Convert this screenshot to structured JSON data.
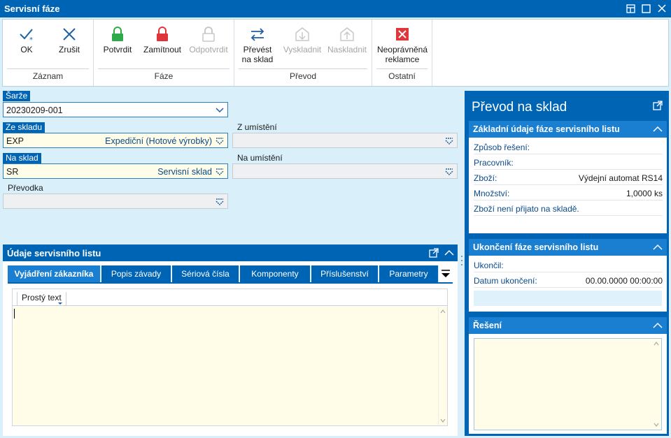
{
  "window": {
    "title": "Servisní fáze",
    "controls": [
      "restore-icon",
      "maximize-icon",
      "close-icon"
    ]
  },
  "ribbon": {
    "groups": [
      {
        "name": "Záznam",
        "buttons": [
          {
            "label": "OK",
            "icon": "check-star-icon",
            "enabled": true
          },
          {
            "label": "Zrušit",
            "icon": "x-icon",
            "enabled": true
          }
        ]
      },
      {
        "name": "Fáze",
        "buttons": [
          {
            "label": "Potvrdit",
            "icon": "lock-green-icon",
            "enabled": true
          },
          {
            "label": "Zamítnout",
            "icon": "lock-red-icon",
            "enabled": true
          },
          {
            "label": "Odpotvrdit",
            "icon": "lock-open-icon",
            "enabled": false
          }
        ]
      },
      {
        "name": "Převod",
        "buttons": [
          {
            "label": "Převést\nna sklad",
            "icon": "transfer-arrows-icon",
            "enabled": true
          },
          {
            "label": "Vyskladnit",
            "icon": "warehouse-out-icon",
            "enabled": false
          },
          {
            "label": "Naskladnit",
            "icon": "warehouse-in-icon",
            "enabled": false
          }
        ]
      },
      {
        "name": "Ostatní",
        "buttons": [
          {
            "label": "Neoprávněná\nreklamce",
            "icon": "red-x-box-icon",
            "enabled": true
          }
        ]
      }
    ]
  },
  "form": {
    "sarze_label": "Šarže",
    "sarze_value": "20230209-001",
    "ze_skladu_label": "Ze skladu",
    "ze_skladu_code": "EXP",
    "ze_skladu_name": "Expediční (Hotové výrobky)",
    "z_umisteni_label": "Z umístění",
    "na_sklad_label": "Na sklad",
    "na_sklad_code": "SR",
    "na_sklad_name": "Servisní sklad",
    "na_umisteni_label": "Na umístění",
    "prevodka_label": "Převodka"
  },
  "udaje": {
    "title": "Údaje servisního listu",
    "tabs": [
      "Vyjádření zákazníka",
      "Popis závady",
      "Sériová čísla",
      "Komponenty",
      "Příslušenství",
      "Parametry"
    ],
    "active_tab": "Vyjádření zákazníka",
    "editor_mode": "Prostý text"
  },
  "side": {
    "title": "Převod na sklad",
    "section1": {
      "title": "Základní údaje fáze servisního listu",
      "rows": [
        {
          "label": "Způsob řešení:",
          "value": ""
        },
        {
          "label": "Pracovník:",
          "value": ""
        },
        {
          "label": "Zboží:",
          "value": "Výdejní automat RS14"
        },
        {
          "label": "Množství:",
          "value": "1,0000 ks"
        }
      ],
      "note": "Zboží není přijato na skladě."
    },
    "section2": {
      "title": "Ukončení fáze servisního listu",
      "rows": [
        {
          "label": "Ukončil:",
          "value": ""
        },
        {
          "label": "Datum ukončení:",
          "value": "00.00.0000 00:00:00"
        }
      ]
    },
    "section3": {
      "title": "Řešení"
    }
  },
  "colors": {
    "accent": "#0064b4",
    "tab_active": "#1a7fd0",
    "background": "#d9f0fb",
    "field_active": "#fffde7"
  }
}
